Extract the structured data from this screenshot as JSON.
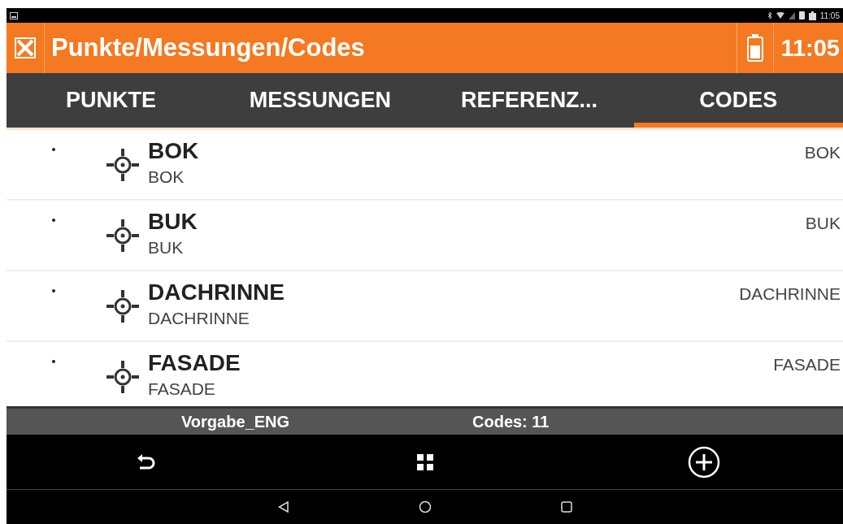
{
  "status_bar": {
    "time": "11:05"
  },
  "header": {
    "title": "Punkte/Messungen/Codes",
    "time": "11:05"
  },
  "tabs": [
    {
      "label": "PUNKTE",
      "selected": false
    },
    {
      "label": "MESSUNGEN",
      "selected": false
    },
    {
      "label": "REFERENZ...",
      "selected": false
    },
    {
      "label": "CODES",
      "selected": true
    }
  ],
  "codes": [
    {
      "name": "BOK",
      "description": "BOK",
      "code": "BOK"
    },
    {
      "name": "BUK",
      "description": "BUK",
      "code": "BUK"
    },
    {
      "name": "DACHRINNE",
      "description": "DACHRINNE",
      "code": "DACHRINNE"
    },
    {
      "name": "FASADE",
      "description": "FASADE",
      "code": "FASADE"
    }
  ],
  "footer": {
    "library": "Vorgabe_ENG",
    "count": "Codes: 11"
  }
}
